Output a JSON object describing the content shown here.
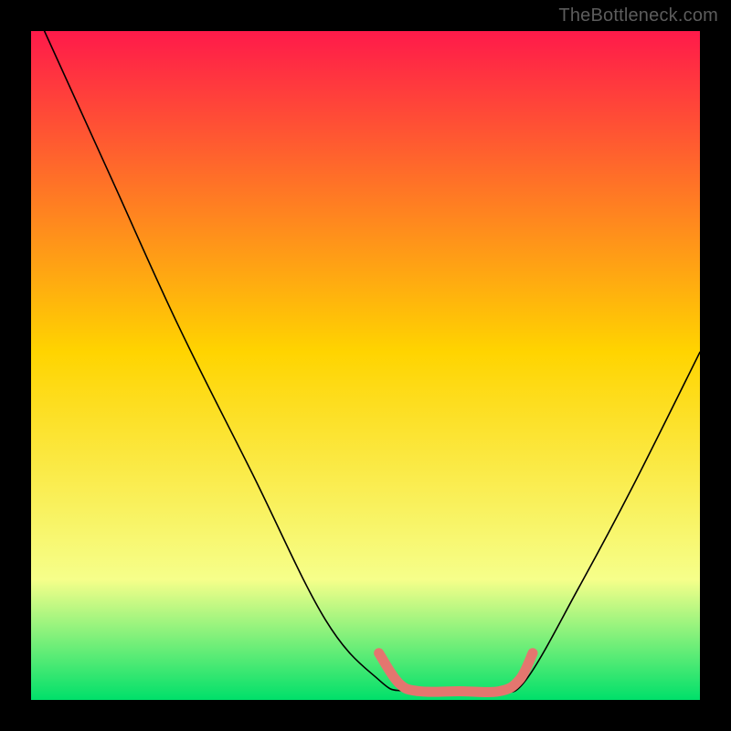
{
  "watermark": "TheBottleneck.com",
  "chart_data": {
    "type": "line",
    "title": "",
    "xlabel": "",
    "ylabel": "",
    "xlim": [
      0,
      100
    ],
    "ylim": [
      0,
      100
    ],
    "gradient_colors": {
      "top": "#ff1a4a",
      "upper_mid": "#ffd400",
      "lower_mid": "#f6ff8a",
      "bottom": "#00e06a"
    },
    "series": [
      {
        "name": "bottleneck-curve",
        "type": "line",
        "color": "#000000",
        "points": [
          {
            "x": 2,
            "y": 100
          },
          {
            "x": 12,
            "y": 78
          },
          {
            "x": 22,
            "y": 56
          },
          {
            "x": 33,
            "y": 34
          },
          {
            "x": 44,
            "y": 12
          },
          {
            "x": 52,
            "y": 3
          },
          {
            "x": 56,
            "y": 1.3
          },
          {
            "x": 64,
            "y": 1.3
          },
          {
            "x": 70,
            "y": 1.3
          },
          {
            "x": 74,
            "y": 3
          },
          {
            "x": 82,
            "y": 17
          },
          {
            "x": 90,
            "y": 32
          },
          {
            "x": 100,
            "y": 52
          }
        ]
      },
      {
        "name": "highlight-range",
        "type": "line",
        "color": "#e4766f",
        "points": [
          {
            "x": 52,
            "y": 7
          },
          {
            "x": 55,
            "y": 2.5
          },
          {
            "x": 58,
            "y": 1.3
          },
          {
            "x": 64,
            "y": 1.3
          },
          {
            "x": 70,
            "y": 1.3
          },
          {
            "x": 73,
            "y": 3
          },
          {
            "x": 75,
            "y": 7
          }
        ]
      }
    ]
  }
}
